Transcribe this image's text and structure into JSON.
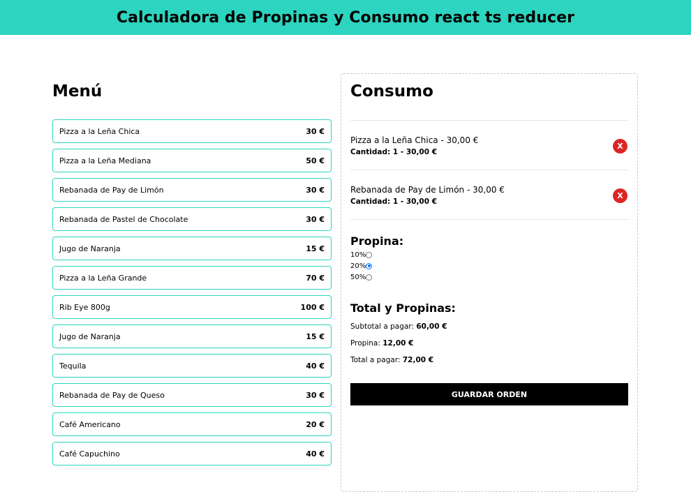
{
  "header": {
    "title": "Calculadora de Propinas y Consumo react ts reducer"
  },
  "menu": {
    "title": "Menú",
    "items": [
      {
        "name": "Pizza a la Leña Chica",
        "price": "30 €"
      },
      {
        "name": "Pizza a la Leña Mediana",
        "price": "50 €"
      },
      {
        "name": "Rebanada de Pay de Limón",
        "price": "30 €"
      },
      {
        "name": "Rebanada de Pastel de Chocolate",
        "price": "30 €"
      },
      {
        "name": "Jugo de Naranja",
        "price": "15 €"
      },
      {
        "name": "Pizza a la Leña Grande",
        "price": "70 €"
      },
      {
        "name": "Rib Eye 800g",
        "price": "100 €"
      },
      {
        "name": "Jugo de Naranja",
        "price": "15 €"
      },
      {
        "name": "Tequila",
        "price": "40 €"
      },
      {
        "name": "Rebanada de Pay de Queso",
        "price": "30 €"
      },
      {
        "name": "Café Americano",
        "price": "20 €"
      },
      {
        "name": "Café Capuchino",
        "price": "40 €"
      }
    ]
  },
  "consumo": {
    "title": "Consumo",
    "items": [
      {
        "name": "Pizza a la Leña Chica - 30,00 €",
        "qty": "Cantidad: 1 - 30,00 €",
        "remove_label": "X"
      },
      {
        "name": "Rebanada de Pay de Limón - 30,00 €",
        "qty": "Cantidad: 1 - 30,00 €",
        "remove_label": "X"
      }
    ]
  },
  "tip": {
    "title": "Propina:",
    "options": [
      {
        "label": "10%",
        "checked": false
      },
      {
        "label": "20%",
        "checked": true
      },
      {
        "label": "50%",
        "checked": false
      }
    ]
  },
  "totals": {
    "title": "Total y Propinas:",
    "subtotal_label": "Subtotal a pagar:",
    "subtotal_value": "60,00 €",
    "tip_label": "Propina:",
    "tip_value": "12,00 €",
    "total_label": "Total a pagar:",
    "total_value": "72,00 €"
  },
  "save_button": "GUARDAR ORDEN",
  "colors": {
    "accent": "#2dd4bf",
    "remove": "#dc2626",
    "button": "#000000"
  }
}
